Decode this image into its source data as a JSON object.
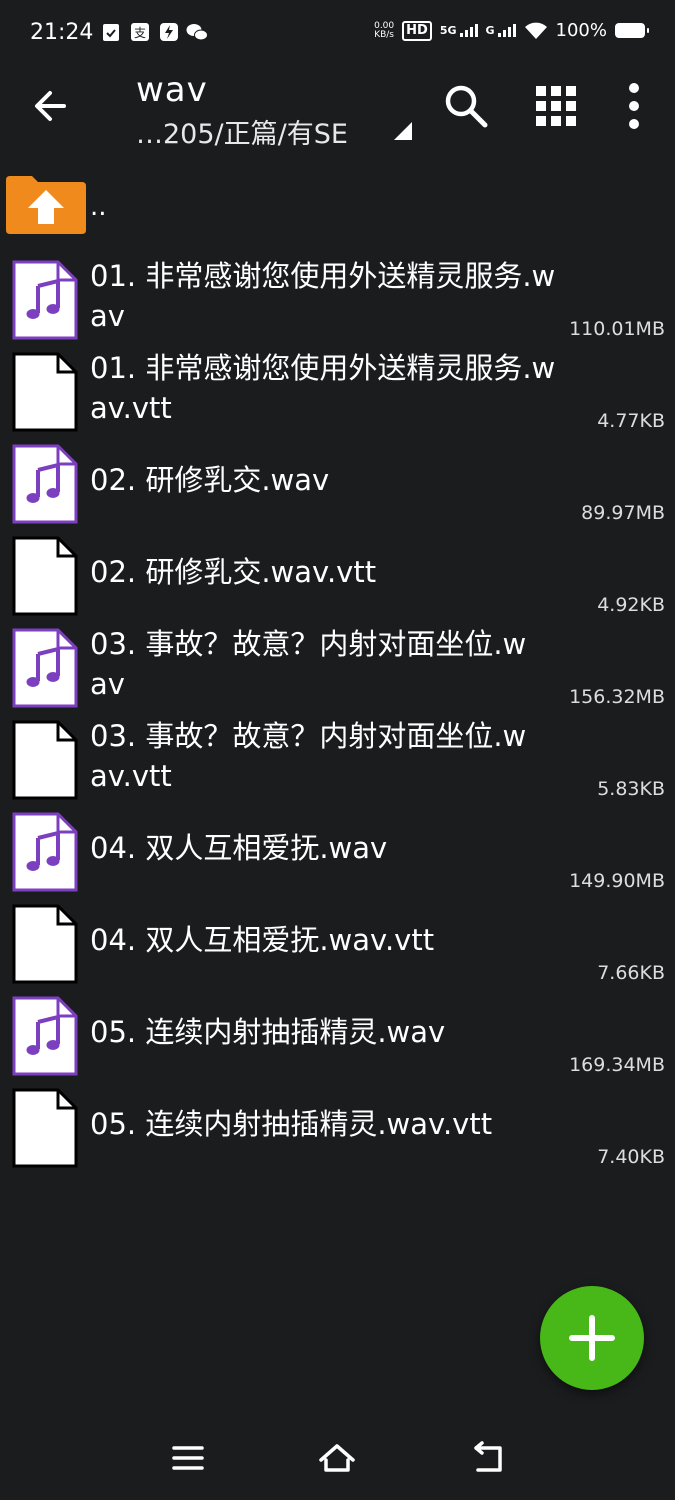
{
  "status_bar": {
    "time": "21:24",
    "net_speed_value": "0.00",
    "net_speed_unit": "KB/s",
    "hd_label": "HD",
    "sig1_label": "5G",
    "sig2_label": "G",
    "battery_text": "100%"
  },
  "toolbar": {
    "title": "wav",
    "path": "…205/正篇/有SE"
  },
  "list": {
    "parent_label": "..",
    "files": [
      {
        "name": "01. 非常感谢您使用外送精灵服务.wav",
        "size": "110.01MB",
        "type": "audio"
      },
      {
        "name": "01. 非常感谢您使用外送精灵服务.wav.vtt",
        "size": "4.77KB",
        "type": "doc"
      },
      {
        "name": "02. 研修乳交.wav",
        "size": "89.97MB",
        "type": "audio"
      },
      {
        "name": "02. 研修乳交.wav.vtt",
        "size": "4.92KB",
        "type": "doc"
      },
      {
        "name": "03. 事故？故意？内射对面坐位.wav",
        "size": "156.32MB",
        "type": "audio"
      },
      {
        "name": "03. 事故？故意？内射对面坐位.wav.vtt",
        "size": "5.83KB",
        "type": "doc"
      },
      {
        "name": "04. 双人互相爱抚.wav",
        "size": "149.90MB",
        "type": "audio"
      },
      {
        "name": "04. 双人互相爱抚.wav.vtt",
        "size": "7.66KB",
        "type": "doc"
      },
      {
        "name": "05. 连续内射抽插精灵.wav",
        "size": "169.34MB",
        "type": "audio"
      },
      {
        "name": "05. 连续内射抽插精灵.wav.vtt",
        "size": "7.40KB",
        "type": "doc"
      }
    ]
  },
  "colors": {
    "background": "#1b1c1e",
    "audio_icon": "#7b3fbf",
    "fab": "#47b818",
    "folder": "#f08a1c"
  }
}
